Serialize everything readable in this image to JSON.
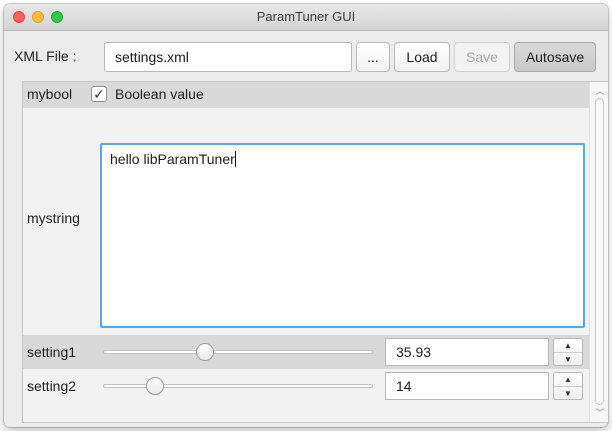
{
  "window": {
    "title": "ParamTuner GUI"
  },
  "file_bar": {
    "label": "XML File :",
    "file_value": "settings.xml",
    "browse_label": "...",
    "load_label": "Load",
    "save_label": "Save",
    "autosave_label": "Autosave",
    "save_enabled": false,
    "autosave_active": true
  },
  "params": {
    "mybool": {
      "name": "mybool",
      "checked": true,
      "check_glyph": "✓",
      "description": "Boolean value"
    },
    "mystring": {
      "name": "mystring",
      "value": "hello libParamTuner"
    },
    "setting1": {
      "name": "setting1",
      "value": "35.93",
      "slider_fraction": 0.37
    },
    "setting2": {
      "name": "setting2",
      "value": "14",
      "slider_fraction": 0.17
    }
  },
  "icons": {
    "spin_up": "▲",
    "spin_down": "▼",
    "scroll_up": "︿",
    "scroll_down": "﹀"
  },
  "colors": {
    "focus_ring": "#5aa7e8",
    "close": "#fc615d",
    "minimize": "#fdbc40",
    "maximize": "#34c84a"
  }
}
